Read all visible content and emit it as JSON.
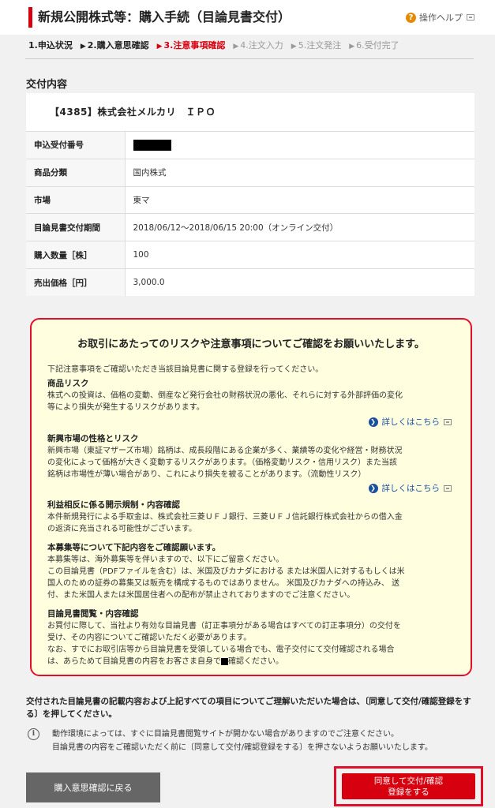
{
  "header": {
    "title": "新規公開株式等：購入手続（目論見書交付）",
    "help_label": "操作ヘルプ"
  },
  "steps": [
    {
      "label": "1.申込状況",
      "state": "done"
    },
    {
      "label": "2.購入意思確認",
      "state": "done"
    },
    {
      "label": "3.注意事項確認",
      "state": "active"
    },
    {
      "label": "4.注文入力",
      "state": "future"
    },
    {
      "label": "5.注文発注",
      "state": "future"
    },
    {
      "label": "6.受付完了",
      "state": "future"
    }
  ],
  "section_title": "交付内容",
  "product_name": "【4385】株式会社メルカリ　ＩＰＯ",
  "info_rows": [
    {
      "label": "申込受付番号",
      "value": ""
    },
    {
      "label": "商品分類",
      "value": "国内株式"
    },
    {
      "label": "市場",
      "value": "東マ"
    },
    {
      "label": "目論見書交付期間",
      "value": "2018/06/12～2018/06/15 20:00（オンライン交付）"
    },
    {
      "label": "購入数量［株］",
      "value": "100"
    },
    {
      "label": "売出価格［円］",
      "value": "3,000.0"
    }
  ],
  "notice": {
    "title": "お取引にあたってのリスクや注意事項についてご確認をお願いいたします。",
    "intro": "下記注意事項をご確認いただき当該目論見書に関する登録を行ってください。",
    "blocks": [
      {
        "heading": "商品リスク",
        "lines": [
          "株式への投資は、価格の変動、倒産など発行会社の財務状況の悪化、それらに対する外部評価の変化",
          "等により損失が発生するリスクがあります。"
        ]
      },
      {
        "heading": "新興市場の性格とリスク",
        "lines": [
          "新興市場（東証マザーズ市場）銘柄は、成長段階にある企業が多く、業績等の変化や経営・財務状況",
          "の変化によって価格が大きく変動するリスクがあります。（価格変動リスク・信用リスク）また当該",
          "銘柄は市場性が薄い場合があり、これにより損失を被ることがあります。（流動性リスク）"
        ]
      },
      {
        "heading": "利益相反に係る開示規制・内容確認",
        "lines": [
          "本件新規発行による手取金は、株式会社三菱ＵＦＪ銀行、三菱ＵＦＪ信託銀行株式会社からの借入金",
          "の返済に充当される可能性がございます。"
        ]
      },
      {
        "heading": "本募集等について下記内容をご確認願います。",
        "lines": [
          "本募集等は、海外募集等を伴いますので、以下にご留意ください。",
          "この目論見書（PDFファイルを含む）は、米国及びカナダにおける または米国人に対するもしくは米",
          "国人のための証券の募集又は販売を構成するものではありません。 米国及びカナダへの持込み、 送",
          "付、また米国人または米国居住者への配布が禁止されておりますのでご注意ください。"
        ]
      },
      {
        "heading": "目論見書閲覧・内容確認",
        "lines": [
          "お買付に際して、当社より有効な目論見書（訂正事項分がある場合はすべての訂正事項分）の交付を",
          "受け、その内容についてご確認いただく必要があります。",
          "なお、すでにお取引店等から目論見書を受領している場合でも、電子交付にて交付確認される場合",
          "は、あらためて目論見書の内容をお客さま自身で"
        ],
        "last_suffix": "確認ください。"
      }
    ],
    "more_label": "詳しくはこちら"
  },
  "confirm_text": "交付された目論見書の記載内容および上記すべての項目についてご理解いただいた場合は、〔同意して交付/確認登録をする〕を押してください。",
  "env_note": [
    "動作環境によっては、すぐに目論見書閲覧サイトが開かない場合がありますのでご注意ください。",
    "目論見書の内容をご確認いただく前に〔同意して交付/確認登録をする〕を押さないようお願いいたします。"
  ],
  "buttons": {
    "back_label": "購入意思確認に戻る",
    "agree_line1": "同意して交付/確認",
    "agree_line2": "登録をする"
  },
  "colors": {
    "accent": "#d7000f",
    "notice_bg": "#ffffdf",
    "link": "#1a4fa0"
  }
}
